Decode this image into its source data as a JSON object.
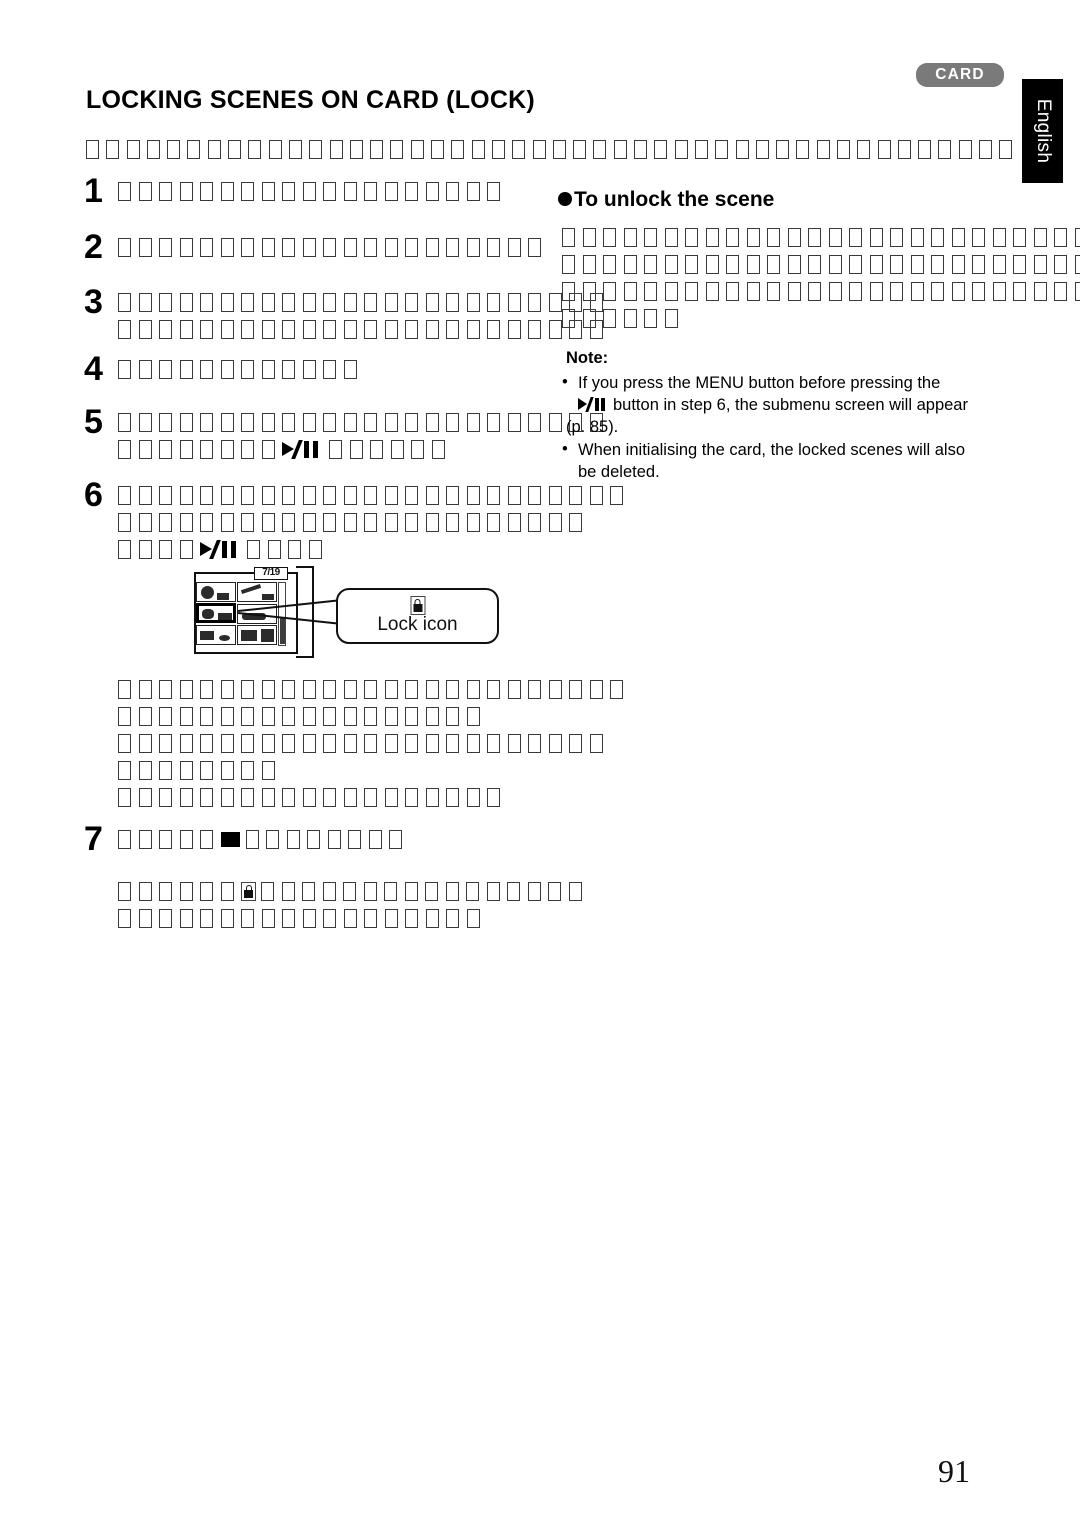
{
  "document": {
    "page_number": "91",
    "language_tab": "English",
    "card_badge": "CARD",
    "title": "LOCKING SCENES ON CARD (LOCK)"
  },
  "intro": {
    "glyph_count": 46
  },
  "steps": [
    {
      "number": "1",
      "lines": [
        {
          "glyphs": 19
        }
      ]
    },
    {
      "number": "2",
      "lines": [
        {
          "glyphs": 21
        }
      ]
    },
    {
      "number": "3",
      "lines": [
        {
          "glyphs": 24
        },
        {
          "glyphs": 24,
          "indent": true
        }
      ]
    },
    {
      "number": "4",
      "lines": [
        {
          "glyphs": 12
        }
      ]
    },
    {
      "number": "5",
      "lines": [
        {
          "glyphs": 24
        },
        {
          "pre": 8,
          "symbol": "play-pause",
          "post": 6,
          "indent": true
        }
      ]
    },
    {
      "number": "6",
      "lines": [
        {
          "glyphs": 25
        },
        {
          "glyphs": 23,
          "indent": true
        },
        {
          "pre": 4,
          "symbol": "play-pause",
          "post": 4,
          "indent": true
        }
      ]
    },
    {
      "number": "7",
      "lines": [
        {
          "pre": 5,
          "symbol": "stop",
          "post": 8
        }
      ]
    }
  ],
  "body_blocks": [
    {
      "lines": [
        {
          "glyphs": 25
        },
        {
          "glyphs": 18
        }
      ]
    },
    {
      "lines": [
        {
          "glyphs": 24
        },
        {
          "glyphs": 8
        }
      ]
    },
    {
      "lines": [
        {
          "glyphs": 19
        }
      ]
    }
  ],
  "step7_body": {
    "lines": [
      {
        "pre": 6,
        "symbol": "lock",
        "post": 16
      },
      {
        "glyphs": 18
      }
    ]
  },
  "right_column": {
    "heading": "To unlock the scene",
    "paragraph_lines": [
      {
        "glyphs": 26
      },
      {
        "glyphs": 27
      },
      {
        "glyphs": 27
      },
      {
        "glyphs": 6
      }
    ],
    "note": {
      "label": "Note:",
      "items": [
        {
          "bullet": "•",
          "line1": "If you press the MENU button before pressing the",
          "line2_pre": "",
          "line2_symbol": "play-pause",
          "line2_post": "button in step 6, the submenu screen will appear",
          "line3": "(p. 85)."
        },
        {
          "bullet": "•",
          "line1": "When initialising the card, the locked scenes will also",
          "line2": "be deleted."
        }
      ]
    }
  },
  "figure": {
    "counter": "7/19",
    "callout_label": "Lock icon",
    "callout_icon": "lock-icon",
    "thumbnail_count": 6,
    "selected_thumbnail_index": 2
  }
}
